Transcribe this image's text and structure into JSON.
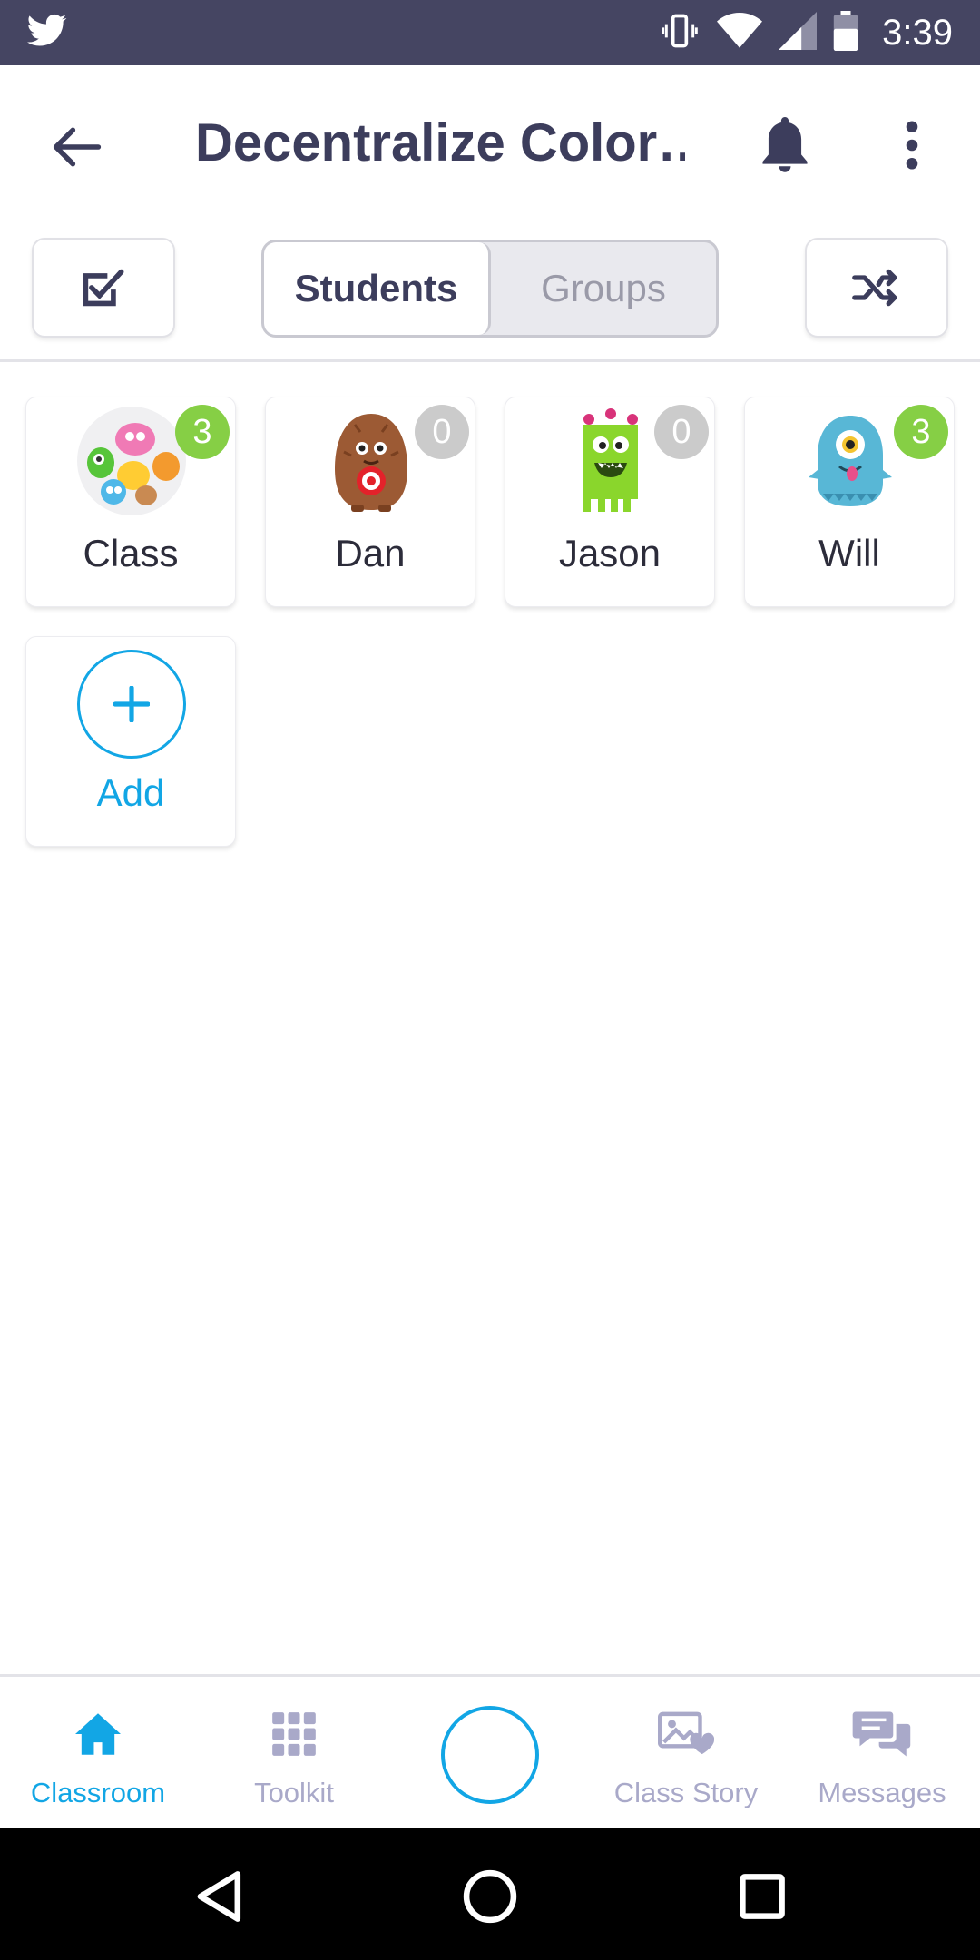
{
  "status_bar": {
    "app_icon": "twitter-icon",
    "icons": [
      "vibrate-icon",
      "wifi-icon",
      "signal-icon",
      "battery-icon"
    ],
    "time": "3:39"
  },
  "app_bar": {
    "back_icon": "arrow-left-icon",
    "title": "Decentralize Color…",
    "bell_icon": "bell-icon",
    "more_icon": "more-vertical-icon"
  },
  "toolbar": {
    "select_icon": "checkbox-edit-icon",
    "segment": {
      "selected": "Students",
      "other": "Groups"
    },
    "shuffle_icon": "shuffle-icon"
  },
  "students": [
    {
      "name": "Class",
      "points": "3",
      "badge_color": "#86cf45",
      "avatar": "class-group-avatar"
    },
    {
      "name": "Dan",
      "points": "0",
      "badge_color": "#cbcbcb",
      "avatar": "brown-monster-avatar"
    },
    {
      "name": "Jason",
      "points": "0",
      "badge_color": "#cbcbcb",
      "avatar": "green-monster-avatar"
    },
    {
      "name": "Will",
      "points": "3",
      "badge_color": "#86cf45",
      "avatar": "blue-cyclops-avatar"
    }
  ],
  "add_card": {
    "label": "Add",
    "icon": "plus-icon"
  },
  "bottom_nav": {
    "items": [
      {
        "label": "Classroom",
        "icon": "home-icon",
        "active": true
      },
      {
        "label": "Toolkit",
        "icon": "grid-icon",
        "active": false
      },
      {
        "label": "Class Story",
        "icon": "image-heart-icon",
        "active": false
      },
      {
        "label": "Messages",
        "icon": "chat-bubbles-icon",
        "active": false
      }
    ]
  },
  "colors": {
    "status_bar": "#454562",
    "accent": "#12a6e5",
    "title": "#3c3d5c",
    "badge_green": "#86cf45",
    "badge_gray": "#cbcbcb",
    "nav_inactive": "#a9a9c9"
  }
}
